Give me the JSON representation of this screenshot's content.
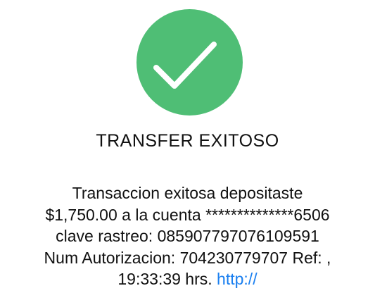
{
  "status": {
    "icon": "checkmark-icon",
    "success_color": "#4fbe75",
    "title": "TRANSFER EXITOSO"
  },
  "message": {
    "line1": "Transaccion exitosa depositaste",
    "line2": "$1,750.00 a la cuenta **************6506",
    "line3": "clave rastreo: 085907797076109591",
    "line4": "Num Autorizacion: 704230779707 Ref:  ,",
    "line5_time": "19:33:39 hrs.",
    "link_text": "http://",
    "link_color": "#1a7ff0"
  }
}
